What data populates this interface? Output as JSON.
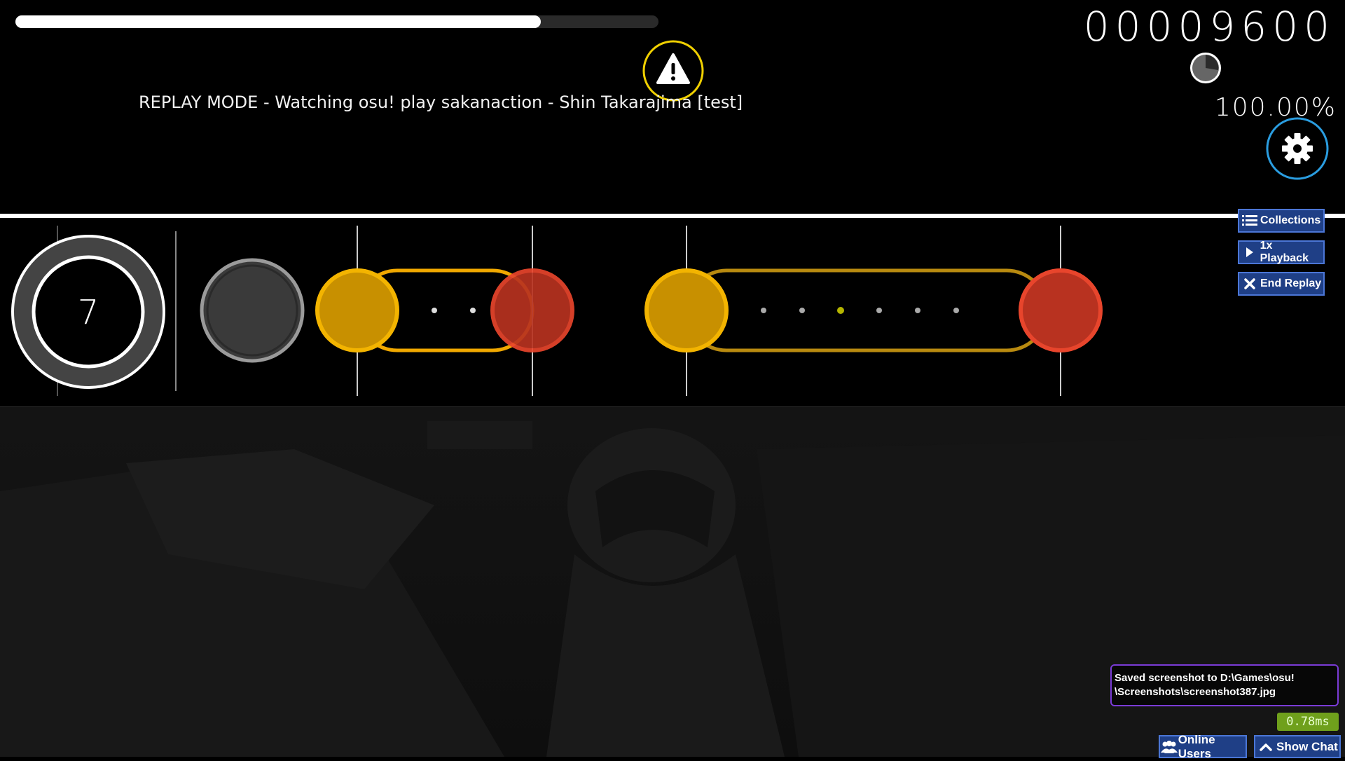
{
  "progress": {
    "fraction": 0.817
  },
  "score": "00009600",
  "accuracy": "100.00%",
  "replay_banner": "REPLAY MODE - Watching osu! play sakanaction - Shin Takarajima [test]",
  "combo_number": "7",
  "side_buttons": {
    "collections_label": "Collections",
    "playback_label": "1x Playback",
    "end_replay_label": "End Replay"
  },
  "notification": {
    "line1": "Saved screenshot to D:\\Games\\osu!",
    "line2": "\\Screenshots\\screenshot387.jpg"
  },
  "frame_time": "0.78ms",
  "bottom_buttons": {
    "online_users_label": "Online Users",
    "show_chat_label": "Show Chat"
  },
  "icons": {
    "warning": "warning-icon",
    "settings": "gear-icon",
    "pie": "time-pie-icon",
    "list": "list-icon",
    "play": "play-icon",
    "close": "close-icon",
    "users": "users-icon",
    "chevron": "chevron-up-icon"
  },
  "colors": {
    "hit_circle_yellow": "#c89000",
    "hit_circle_yellow_border": "#f3b400",
    "hit_circle_red": "#b83220",
    "hit_circle_red_border": "#e8452c",
    "slider_border": "#f0a800",
    "button_blue": "#1f3f86",
    "settings_ring": "#2a9de0",
    "warning_ring": "#f0d000"
  }
}
